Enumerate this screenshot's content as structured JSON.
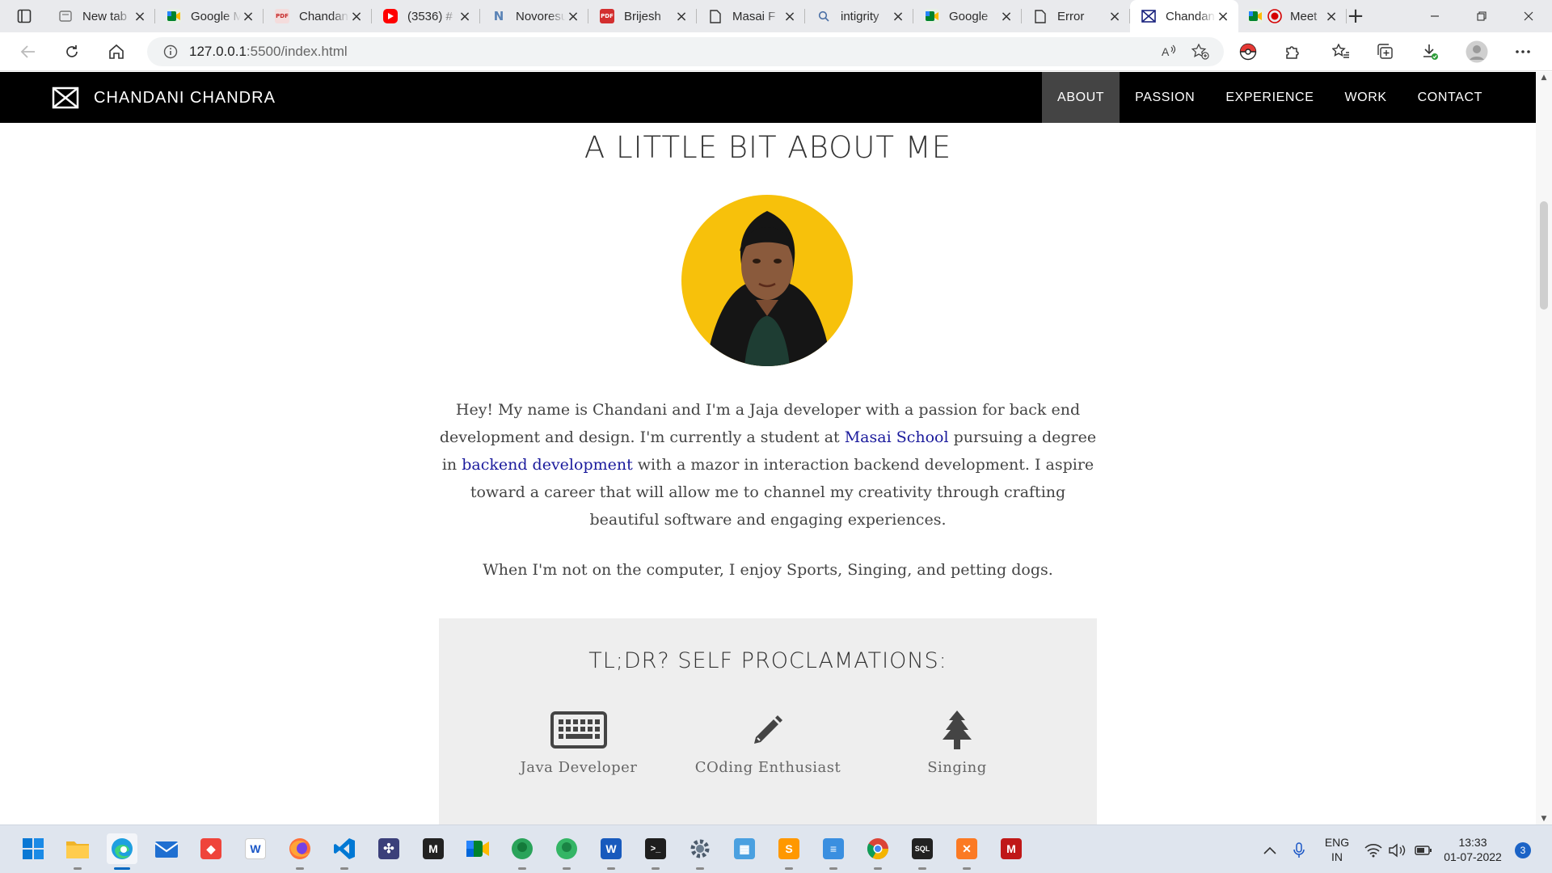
{
  "browser": {
    "tabs": [
      {
        "label": "New tab",
        "icon": "newtab-icon",
        "active": false
      },
      {
        "label": "Google Meet",
        "icon": "google-meet-icon",
        "active": false
      },
      {
        "label": "Chandani",
        "icon": "pdf-icon",
        "active": false
      },
      {
        "label": "(3536) #",
        "icon": "youtube-icon",
        "active": false
      },
      {
        "label": "Novoresume",
        "icon": "novoresume-icon",
        "active": false
      },
      {
        "label": "Brijesh",
        "icon": "pdf-icon",
        "active": false
      },
      {
        "label": "Masai F",
        "icon": "document-icon",
        "active": false
      },
      {
        "label": "intigrity",
        "icon": "search-icon",
        "active": false
      },
      {
        "label": "Google",
        "icon": "google-meet-icon",
        "active": false
      },
      {
        "label": "Error",
        "icon": "document-icon",
        "active": false
      },
      {
        "label": "Chandani",
        "icon": "site-logo-icon",
        "active": true
      },
      {
        "label": "Meet",
        "icon": "recording-icon",
        "active": false
      }
    ],
    "address": {
      "host": "127.0.0.1",
      "rest": ":5500/index.html"
    }
  },
  "site": {
    "brand": "CHANDANI CHANDRA",
    "nav": [
      {
        "label": "ABOUT",
        "active": true
      },
      {
        "label": "PASSION",
        "active": false
      },
      {
        "label": "EXPERIENCE",
        "active": false
      },
      {
        "label": "WORK",
        "active": false
      },
      {
        "label": "CONTACT",
        "active": false
      }
    ]
  },
  "about": {
    "title": "A LITTLE BIT ABOUT ME",
    "paragraph": {
      "part1": "Hey! My name is Chandani and I'm a Jaja developer with a passion for back end development and design. I'm currently a student at ",
      "link1": "Masai School",
      "part2": " pursuing a degree in ",
      "link2": "backend development",
      "part3": " with a mazor in interaction backend development. I aspire toward a career that will allow me to channel my creativity through crafting beautiful software and engaging experiences."
    },
    "hobbies": "When I'm not on the computer, I enjoy Sports, Singing, and petting dogs."
  },
  "tldr": {
    "title": "TL;DR?  SELF PROCLAMATIONS:",
    "items": [
      {
        "label": "Java Developer",
        "icon": "keyboard-icon"
      },
      {
        "label": "COding Enthusiast",
        "icon": "pencil-icon"
      },
      {
        "label": "Singing",
        "icon": "tree-icon"
      }
    ]
  },
  "taskbar": {
    "apps": [
      "start",
      "file-explorer",
      "edge",
      "mail",
      "anydesk",
      "news",
      "firefox",
      "vscode",
      "ide",
      "medium",
      "meet",
      "gitkraken",
      "gitkraken-2",
      "word",
      "terminal",
      "settings",
      "control-panel",
      "sublime",
      "notepad",
      "chrome",
      "mysql",
      "xampp",
      "mcafee"
    ],
    "language": [
      "ENG",
      "IN"
    ],
    "time": "13:33",
    "date": "01-07-2022",
    "notifications": "3"
  },
  "colors": {
    "nav_bg": "#000000",
    "nav_active": "#444444",
    "link": "#1a1a9c",
    "avatar_bg": "#f7c10b",
    "panel_bg": "#eeeeee"
  }
}
